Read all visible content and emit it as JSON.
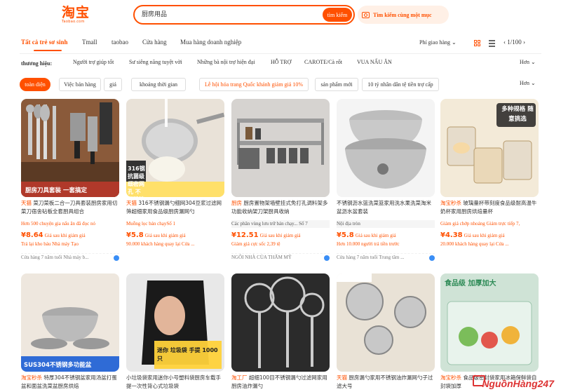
{
  "header": {
    "logo_cn": "淘宝",
    "logo_sub": "Taobao.com",
    "search_value": "厨房用品",
    "search_button": "tìm kiếm",
    "image_search": "Tìm kiếm cùng một mục"
  },
  "tabs": [
    "Tất cả trẻ sơ sinh",
    "Tmall",
    "taobao",
    "Cửa hàng",
    "Mua hàng doanh nghiệp"
  ],
  "toolbar": {
    "sort": "Phí giao hàng",
    "sort_caret": "⌄",
    "pager": "‹ 1/100 ›"
  },
  "brands": {
    "label": "thương hiệu:",
    "items": [
      "Người trợ giúp tốt",
      "Sư siêng năng tuyệt vời",
      "Những bà nội trợ hiện đại",
      "HỖ TRỢ",
      "CAROTE/Cà rốt",
      "VUA NẤU ĂN"
    ],
    "more": "Hơn ⌄"
  },
  "filters": {
    "items": [
      "toàn diện",
      "Việc bán hàng",
      "giá",
      "khoảng thời gian",
      "Lễ hội hóa trang Quốc khánh giảm giá 10%",
      "sản phẩm mới",
      "10 tỷ nhân dân tệ tiền trợ cấp"
    ],
    "more": "Hơn ⌄"
  },
  "products": [
    {
      "tag": "天猫",
      "title": "菜刀菜板二合一刀具套装厨房家用切菜刀宿舍砧板全套厨具组合",
      "overlay": "厨房刀具套装 一套搞定",
      "note": "Hơn 500 chuyện gia nấu ăn đã đọc nó",
      "note_color": "#ff5000",
      "note_bg": "#fff",
      "price": "¥8.64",
      "price_label": "Giá sau khi giảm giá",
      "sub": "Trả lại kho báu   Nhà máy Tạo",
      "sub_color": "#ff5000",
      "store": "Cửa hàng 7 năm tuổi Nhà máy b..."
    },
    {
      "tag": "天猫",
      "title": "316不锈钢漏勺细网304豆浆过滤网筛超细家用食品级厨房漏网勺",
      "overlay": "316钢 抗菌级 细密网孔 不留残渣",
      "note": "Muỗng lọc bán chạySố 1",
      "note_color": "#ff5000",
      "note_bg": "#fff",
      "price": "¥5.8",
      "price_label": "Giá sau khi giảm giá",
      "sub": "90.000 khách hàng quay lại Cửa ...",
      "sub_color": "#ff5000",
      "store": ""
    },
    {
      "tag": "厨房",
      "title": "厨房置物架墙壁挂式免打孔调料架多功能收纳架刀架厨具收纳",
      "overlay": "",
      "note": "Các phân vùng lưu trữ bán chạy... Số 7",
      "note_color": "#555",
      "note_bg": "#f5f5f5",
      "price": "¥12.51",
      "price_label": "Giá sau khi giảm giá",
      "sub": "Giảm giá cực sốc 2,39 tệ",
      "sub_color": "#ff5000",
      "store": "NGÔI NHÀ CỦA THẨM MỸ"
    },
    {
      "tag": "",
      "title": "不锈钢沥水篮洗菜篮家用洗水果洗菜淘米盆沥水盆套装",
      "overlay": "",
      "note": "Nội địa    tròn",
      "note_color": "#555",
      "note_bg": "#f5f5f5",
      "price": "¥5.8",
      "price_label": "Giá sau khi giảm giá",
      "sub": "Hơn 10.000 người trả tiền trước",
      "sub_color": "#ff5000",
      "store": "Cửa hàng 7 năm tuổi Trung tâm ..."
    },
    {
      "tag": "淘宝秒杀",
      "title": "玻璃量杯带刻度食品级耐高温牛奶杯家用厨房烘焙量杯",
      "overlay": "多种规格 随意挑选",
      "note": "Giảm giá chớp nhoáng Giảm trực tiếp 7,",
      "note_color": "#ff5000",
      "note_bg": "#fff",
      "price": "¥4.38",
      "price_label": "Giá sau khi giảm giá",
      "sub": "20.000 khách hàng quay lại Cửa ...",
      "sub_color": "#ff5000",
      "store": ""
    },
    {
      "tag": "淘宝秒杀",
      "title": "特厚304不锈钢盆家用汤盆打蛋盆和面盆洗菜盆厨房烘焙",
      "overlay": "SUS304不锈钢多功能盆",
      "note": "",
      "note_color": "#555",
      "note_bg": "#fff",
      "price": "",
      "price_label": "",
      "sub": "",
      "sub_color": "#ff5000",
      "store": ""
    },
    {
      "tag": "",
      "title": "小垃圾袋家用迷你小号塑料袋厨房车载手提一次性背心式垃圾袋",
      "overlay": "迷你 垃圾袋 手提 1000只",
      "note": "",
      "note_color": "#555",
      "note_bg": "#fff",
      "price": "",
      "price_label": "",
      "sub": "",
      "sub_color": "#ff5000",
      "store": ""
    },
    {
      "tag": "淘工厂",
      "title": "超细100目不锈钢漏勺过滤网家用厨房油炸漏勺",
      "overlay": "",
      "note": "",
      "note_color": "#555",
      "note_bg": "#fff",
      "price": "",
      "price_label": "",
      "sub": "",
      "sub_color": "#ff5000",
      "store": ""
    },
    {
      "tag": "天猫",
      "title": "厨房漏勺家用不锈钢油炸漏网勺子过滤大号",
      "overlay": "",
      "note": "",
      "note_color": "#555",
      "note_bg": "#fff",
      "price": "",
      "price_label": "",
      "sub": "",
      "sub_color": "#ff5000",
      "store": ""
    },
    {
      "tag": "淘宝秒杀",
      "title": "食品级密封袋家用冰箱保鲜袋自封袋加厚",
      "overlay": "食品级 加厚加大",
      "note": "",
      "note_color": "#555",
      "note_bg": "#fff",
      "price": "",
      "price_label": "",
      "sub": "",
      "sub_color": "#ff5000",
      "store": ""
    }
  ],
  "watermark": "NguồnHàng247",
  "colors": {
    "accent": "#ff5000",
    "link_blue": "#3a8ef6"
  }
}
